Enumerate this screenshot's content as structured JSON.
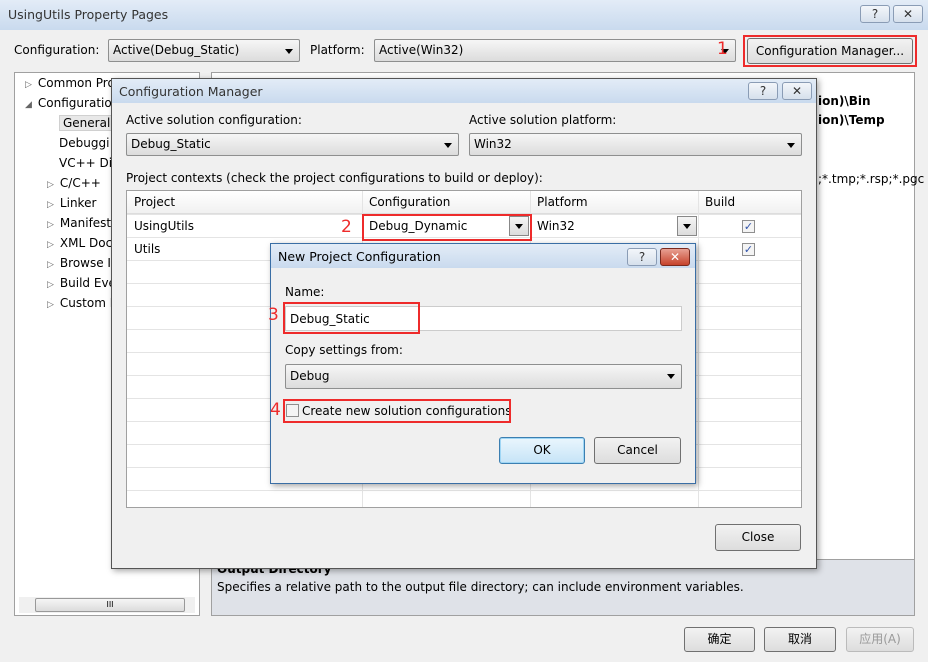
{
  "main": {
    "title": "UsingUtils Property Pages",
    "help": "?",
    "close": "✕",
    "configuration_label": "Configuration:",
    "configuration_value": "Active(Debug_Static)",
    "platform_label": "Platform:",
    "platform_value": "Active(Win32)",
    "config_manager_button": "Configuration Manager...",
    "tree": [
      {
        "label": "Common Pro",
        "expander": "▷"
      },
      {
        "label": "Configuratio",
        "expander": "◢"
      },
      {
        "label": "General",
        "expander": ""
      },
      {
        "label": "Debuggi",
        "expander": ""
      },
      {
        "label": "VC++ Di",
        "expander": ""
      },
      {
        "label": "C/C++",
        "expander": "▷"
      },
      {
        "label": "Linker",
        "expander": "▷"
      },
      {
        "label": "Manifest",
        "expander": "▷"
      },
      {
        "label": "XML Doc",
        "expander": "▷"
      },
      {
        "label": "Browse I",
        "expander": "▷"
      },
      {
        "label": "Build Eve",
        "expander": "▷"
      },
      {
        "label": "Custom B",
        "expander": "▷"
      }
    ],
    "grid_values": [
      "ion)\\Bin",
      "ion)\\Temp",
      ";*.tmp;*.rsp;*.pgc"
    ],
    "description_title": "Output Directory",
    "description_text": "Specifies a relative path to the output file directory; can include environment variables.",
    "ok": "确定",
    "cancel": "取消",
    "apply": "应用(A)",
    "scroll_thumb": "III"
  },
  "config_manager": {
    "title": "Configuration Manager",
    "active_config_label": "Active solution configuration:",
    "active_config_value": "Debug_Static",
    "active_platform_label": "Active solution platform:",
    "active_platform_value": "Win32",
    "contexts_label": "Project contexts (check the project configurations to build or deploy):",
    "columns": [
      "Project",
      "Configuration",
      "Platform",
      "Build"
    ],
    "rows": [
      {
        "project": "UsingUtils",
        "configuration": "Debug_Dynamic",
        "platform": "Win32",
        "build": true
      },
      {
        "project": "Utils",
        "configuration": "",
        "platform": "",
        "build": true
      }
    ],
    "close_button": "Close"
  },
  "new_config": {
    "title": "New Project Configuration",
    "name_label": "Name:",
    "name_value": "Debug_Static",
    "copy_label": "Copy settings from:",
    "copy_value": "Debug",
    "create_solution_label": "Create new solution configurations",
    "create_solution_checked": false,
    "ok": "OK",
    "cancel": "Cancel"
  },
  "annotations": [
    "1",
    "2",
    "3",
    "4"
  ],
  "colors": {
    "annotation": "#ee2b2b",
    "title_bar": "#c9daee"
  }
}
